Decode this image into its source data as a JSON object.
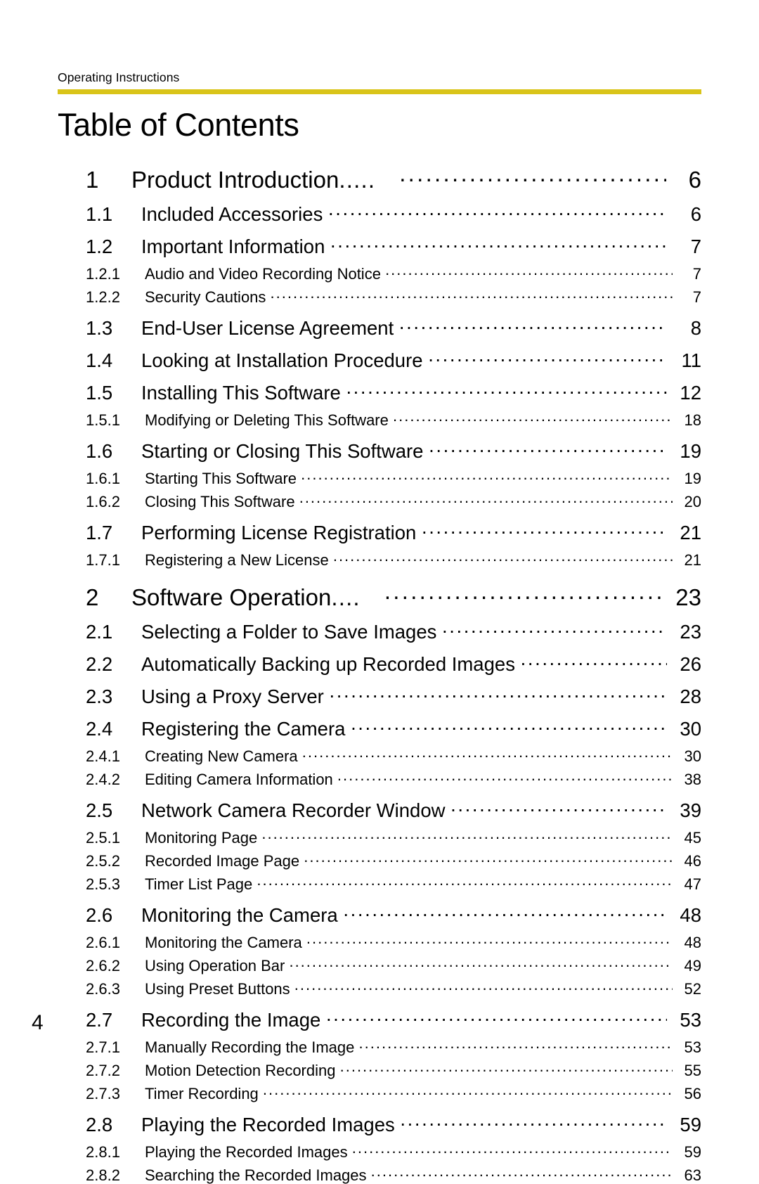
{
  "header": {
    "running_head": "Operating Instructions",
    "rule_color": "#d9c419"
  },
  "title": "Table of Contents",
  "footer": {
    "page_number": "4"
  },
  "toc": {
    "entries": [
      {
        "level": 1,
        "number": "1",
        "label": "Product Introduction",
        "trailing_dots": ".....",
        "page": "6"
      },
      {
        "level": 2,
        "number": "1.1",
        "label": "Included Accessories",
        "page": "6"
      },
      {
        "level": 2,
        "number": "1.2",
        "label": "Important Information",
        "page": "7"
      },
      {
        "level": 3,
        "number": "1.2.1",
        "label": "Audio and Video Recording Notice",
        "page": "7"
      },
      {
        "level": 3,
        "number": "1.2.2",
        "label": "Security Cautions",
        "page": "7"
      },
      {
        "level": 2,
        "number": "1.3",
        "label": "End-User License Agreement",
        "page": "8"
      },
      {
        "level": 2,
        "number": "1.4",
        "label": "Looking at Installation Procedure",
        "page": "11"
      },
      {
        "level": 2,
        "number": "1.5",
        "label": "Installing This Software",
        "page": "12"
      },
      {
        "level": 3,
        "number": "1.5.1",
        "label": "Modifying or Deleting This Software",
        "page": "18"
      },
      {
        "level": 2,
        "number": "1.6",
        "label": "Starting or Closing This Software",
        "page": "19"
      },
      {
        "level": 3,
        "number": "1.6.1",
        "label": "Starting This Software",
        "page": "19"
      },
      {
        "level": 3,
        "number": "1.6.2",
        "label": "Closing This Software",
        "page": "20"
      },
      {
        "level": 2,
        "number": "1.7",
        "label": "Performing License Registration",
        "page": "21"
      },
      {
        "level": 3,
        "number": "1.7.1",
        "label": "Registering a New License",
        "page": "21"
      },
      {
        "level": 1,
        "number": "2",
        "label": "Software Operation",
        "trailing_dots": "....",
        "page": "23"
      },
      {
        "level": 2,
        "number": "2.1",
        "label": "Selecting a Folder to Save Images",
        "page": "23"
      },
      {
        "level": 2,
        "number": "2.2",
        "label": "Automatically Backing up Recorded Images",
        "page": "26"
      },
      {
        "level": 2,
        "number": "2.3",
        "label": "Using a Proxy Server",
        "page": "28"
      },
      {
        "level": 2,
        "number": "2.4",
        "label": "Registering the Camera",
        "page": "30"
      },
      {
        "level": 3,
        "number": "2.4.1",
        "label": "Creating New Camera",
        "page": "30"
      },
      {
        "level": 3,
        "number": "2.4.2",
        "label": "Editing Camera Information",
        "page": "38"
      },
      {
        "level": 2,
        "number": "2.5",
        "label": "Network Camera Recorder Window",
        "page": "39"
      },
      {
        "level": 3,
        "number": "2.5.1",
        "label": "Monitoring Page",
        "page": "45"
      },
      {
        "level": 3,
        "number": "2.5.2",
        "label": "Recorded Image Page",
        "page": "46"
      },
      {
        "level": 3,
        "number": "2.5.3",
        "label": "Timer List Page",
        "page": "47"
      },
      {
        "level": 2,
        "number": "2.6",
        "label": "Monitoring the Camera",
        "page": "48"
      },
      {
        "level": 3,
        "number": "2.6.1",
        "label": "Monitoring the Camera",
        "page": "48"
      },
      {
        "level": 3,
        "number": "2.6.2",
        "label": "Using Operation Bar",
        "page": "49"
      },
      {
        "level": 3,
        "number": "2.6.3",
        "label": "Using Preset Buttons",
        "page": "52"
      },
      {
        "level": 2,
        "number": "2.7",
        "label": "Recording the Image",
        "page": "53"
      },
      {
        "level": 3,
        "number": "2.7.1",
        "label": "Manually Recording the Image",
        "page": "53"
      },
      {
        "level": 3,
        "number": "2.7.2",
        "label": "Motion Detection Recording",
        "page": "55"
      },
      {
        "level": 3,
        "number": "2.7.3",
        "label": "Timer Recording",
        "page": "56"
      },
      {
        "level": 2,
        "number": "2.8",
        "label": "Playing the Recorded Images",
        "page": "59"
      },
      {
        "level": 3,
        "number": "2.8.1",
        "label": "Playing the Recorded Images",
        "page": "59"
      },
      {
        "level": 3,
        "number": "2.8.2",
        "label": "Searching the Recorded Images",
        "page": "63"
      }
    ]
  }
}
